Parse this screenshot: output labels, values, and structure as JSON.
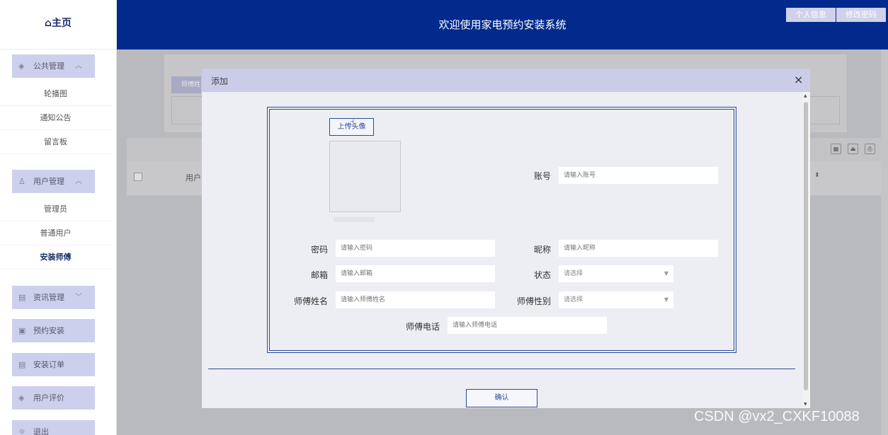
{
  "sidebar": {
    "home_label": "⌂主页",
    "groups": [
      {
        "label": "公共管理",
        "items": [
          "轮播图",
          "通知公告",
          "留言板"
        ]
      },
      {
        "label": "用户管理",
        "items": [
          "管理员",
          "普通用户",
          "安装师傅"
        ]
      },
      {
        "label": "资讯管理"
      },
      {
        "label": "预约安装"
      },
      {
        "label": "安装订单"
      },
      {
        "label": "用户评价"
      },
      {
        "label": "退出"
      }
    ],
    "active_item": "安装师傅"
  },
  "header": {
    "title": "欢迎使用家电预约安装系统",
    "btn_profile": "个人信息",
    "btn_password": "修改密码"
  },
  "background": {
    "chip_label": "师傅姓",
    "table_col": "用户"
  },
  "modal": {
    "title": "添加",
    "close": "×",
    "upload_label": "上传头像",
    "fields": {
      "account": {
        "label": "账号",
        "placeholder": "请输入账号"
      },
      "password": {
        "label": "密码",
        "placeholder": "请输入密码"
      },
      "nickname": {
        "label": "昵称",
        "placeholder": "请输入昵称"
      },
      "email": {
        "label": "邮箱",
        "placeholder": "请输入邮箱"
      },
      "status": {
        "label": "状态",
        "placeholder": "请选择"
      },
      "name": {
        "label": "师傅姓名",
        "placeholder": "请输入师傅姓名"
      },
      "gender": {
        "label": "师傅性别",
        "placeholder": "请选择"
      },
      "phone": {
        "label": "师傅电话",
        "placeholder": "请输入师傅电话"
      }
    },
    "confirm_label": "确认"
  },
  "watermark": "CSDN @vx2_CXKF10088",
  "colors": {
    "header_bg": "#022a8c",
    "accent": "#2d4a9a",
    "menu_bg": "#cdd0ed"
  }
}
